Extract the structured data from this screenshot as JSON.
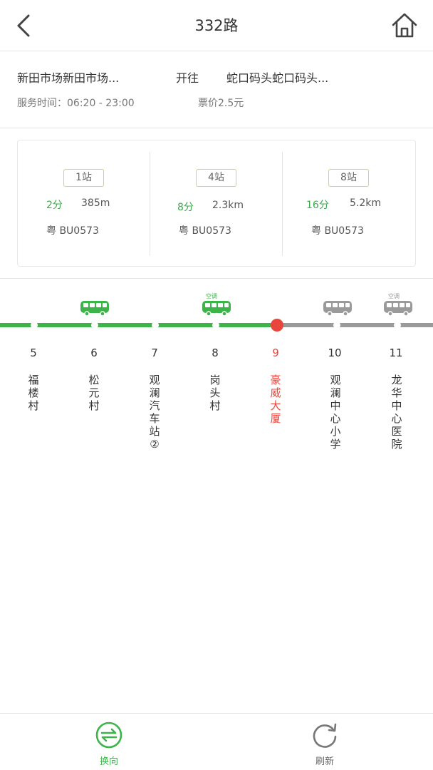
{
  "header": {
    "title": "332路",
    "back_icon": "chevron-left-icon",
    "home_icon": "home-icon"
  },
  "route": {
    "from": "新田市场新田市场...",
    "direction": "开往",
    "to": "蛇口码头蛇口码头...",
    "service_time": "服务时间：06:20 - 23:00",
    "fare": "票价2.5元"
  },
  "arrivals": [
    {
      "stops": "1站",
      "minutes": "2分",
      "distance": "385m",
      "plate": "粤 BU0573"
    },
    {
      "stops": "4站",
      "minutes": "8分",
      "distance": "2.3km",
      "plate": "粤 BU0573"
    },
    {
      "stops": "8站",
      "minutes": "16分",
      "distance": "5.2km",
      "plate": "粤 BU0573"
    }
  ],
  "stops": [
    {
      "num": "5",
      "name": "福楼村"
    },
    {
      "num": "6",
      "name": "松元村"
    },
    {
      "num": "7",
      "name": "观澜汽车站②"
    },
    {
      "num": "8",
      "name": "岗头村"
    },
    {
      "num": "9",
      "name": "豪威大厦"
    },
    {
      "num": "10",
      "name": "观澜中心小学"
    },
    {
      "num": "11",
      "name": "龙华中心医院"
    }
  ],
  "current_stop_index": 4,
  "buses": [
    {
      "at_stop": "6",
      "ac_label": "",
      "status": "passed"
    },
    {
      "at_stop": "8",
      "ac_label": "空调",
      "status": "passed"
    },
    {
      "at_stop": "10",
      "ac_label": "",
      "status": "upcoming"
    },
    {
      "at_stop": "11",
      "ac_label": "空调",
      "status": "upcoming"
    }
  ],
  "tabs": [
    {
      "label": "换向",
      "icon": "switch-direction-icon",
      "active": true
    },
    {
      "label": "刷新",
      "icon": "refresh-icon",
      "active": false
    }
  ],
  "colors": {
    "green": "#3cb44a",
    "gray": "#9a9a9a",
    "red": "#e8453c",
    "badge_border": "#e6cc6a"
  }
}
